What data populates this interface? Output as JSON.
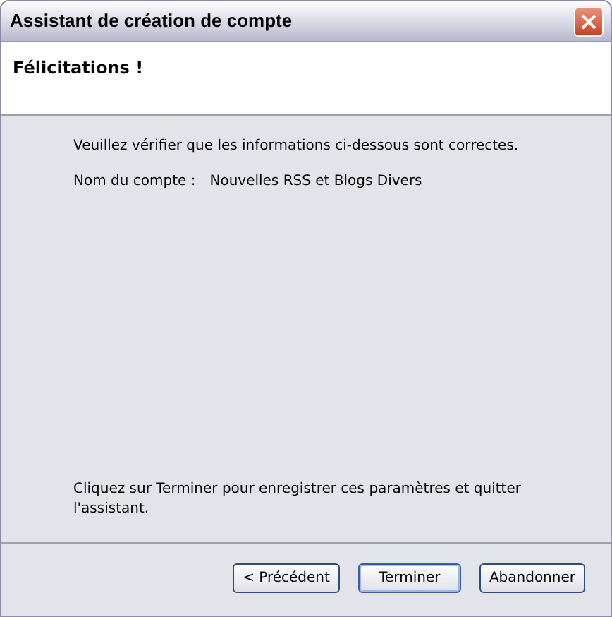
{
  "window": {
    "title": "Assistant de création de compte"
  },
  "header": {
    "title": "Félicitations !"
  },
  "body": {
    "intro": "Veuillez vérifier que les informations ci-dessous sont correctes.",
    "fields": [
      {
        "label": "Nom du compte :",
        "value": "Nouvelles RSS et Blogs Divers"
      }
    ],
    "outro": "Cliquez sur Terminer pour enregistrer ces paramètres et quitter l'assistant."
  },
  "buttons": [
    {
      "label": "< Précédent",
      "default": false
    },
    {
      "label": "Terminer",
      "default": true
    },
    {
      "label": "Abandonner",
      "default": false
    }
  ]
}
